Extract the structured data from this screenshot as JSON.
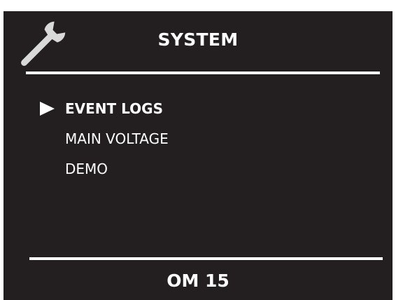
{
  "header": {
    "icon": "wrench-icon",
    "title": "SYSTEM"
  },
  "menu": {
    "items": [
      {
        "label": "EVENT LOGS",
        "selected": true
      },
      {
        "label": "MAIN VOLTAGE",
        "selected": false
      },
      {
        "label": "DEMO",
        "selected": false
      }
    ]
  },
  "footer": {
    "model": "OM 15"
  },
  "colors": {
    "background": "#231f20",
    "foreground": "#ffffff"
  }
}
